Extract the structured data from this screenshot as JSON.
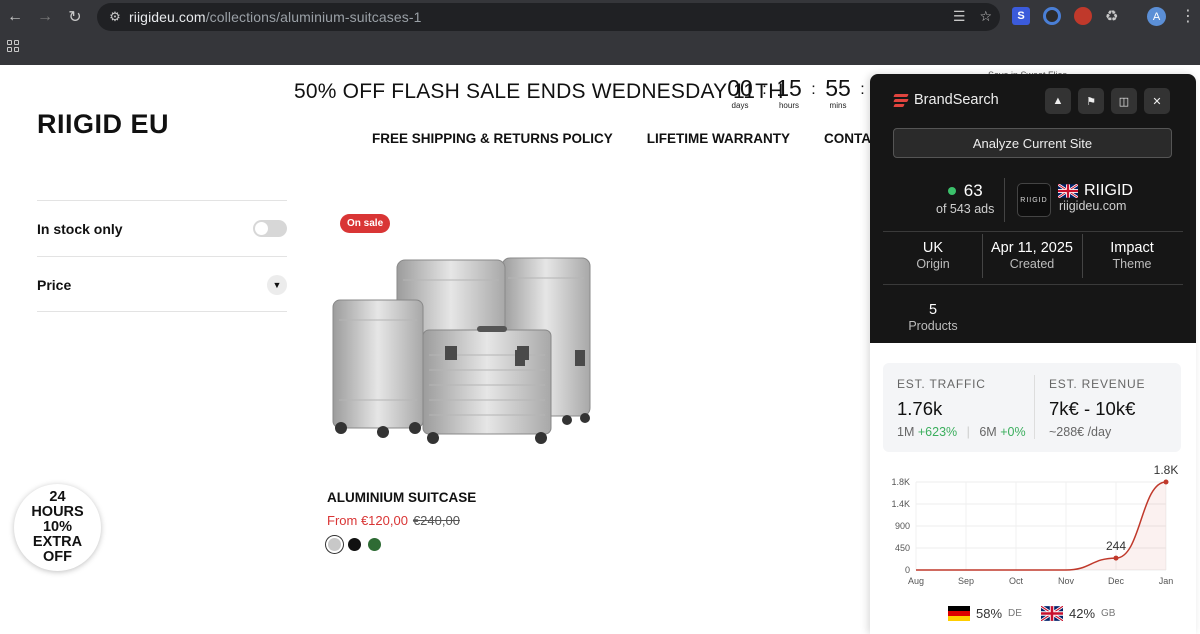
{
  "browser": {
    "url_host": "riigideu.com",
    "url_path": "/collections/aluminium-suitcases-1",
    "profile_initial": "A",
    "extensions": [
      "S",
      "",
      ""
    ]
  },
  "store": {
    "announcement": "50% OFF FLASH SALE ENDS WEDNESDAY 11TH",
    "countdown": [
      {
        "num": "00",
        "label": "days"
      },
      {
        "num": "15",
        "label": "hours"
      },
      {
        "num": "55",
        "label": "mins"
      }
    ],
    "save_tag": "Save in Sweat Flies",
    "logo": "RIIGID EU",
    "nav": [
      "FREE SHIPPING & RETURNS POLICY",
      "LIFETIME WARRANTY",
      "CONTACT"
    ],
    "filters": {
      "in_stock_label": "In stock only",
      "in_stock_on": false,
      "price_label": "Price"
    },
    "product": {
      "badge": "On sale",
      "title": "ALUMINIUM SUITCASE",
      "price_from": "From €120,00",
      "price_was": "€240,00",
      "swatches": [
        "#c8c8c8",
        "#111111",
        "#2e6b34"
      ]
    },
    "promo_badge": [
      "24",
      "HOURS",
      "10%",
      "EXTRA",
      "OFF"
    ]
  },
  "brandsearch": {
    "brand": "BrandSearch",
    "analyze_label": "Analyze Current Site",
    "ads_count": "63",
    "ads_total": "of 543 ads",
    "store_logo_text": "RIIGID",
    "store_name": "RIIGID",
    "store_domain": "riigideu.com",
    "origin": {
      "value": "UK",
      "label": "Origin"
    },
    "created": {
      "value": "Apr 11, 2025",
      "label": "Created"
    },
    "theme": {
      "value": "Impact",
      "label": "Theme"
    },
    "products": {
      "value": "5",
      "label": "Products"
    },
    "traffic": {
      "label": "EST. TRAFFIC",
      "value": "1.76k",
      "m1_label": "1M",
      "m1_change": "+623%",
      "m6_label": "6M",
      "m6_change": "+0%"
    },
    "revenue": {
      "label": "EST. REVENUE",
      "value": "7k€ - 10k€",
      "per_day": "~288€ /day"
    },
    "geo": [
      {
        "pct": "58%",
        "code": "DE"
      },
      {
        "pct": "42%",
        "code": "GB"
      }
    ]
  },
  "chart_data": {
    "type": "area",
    "categories": [
      "Aug",
      "Sep",
      "Oct",
      "Nov",
      "Dec",
      "Jan"
    ],
    "values": [
      0,
      0,
      0,
      0,
      244,
      1800
    ],
    "yticks": [
      "0",
      "450",
      "900",
      "1.4K",
      "1.8K"
    ],
    "ylim": [
      0,
      1800
    ],
    "point_labels": [
      {
        "index": 4,
        "text": "244"
      },
      {
        "index": 5,
        "text": "1.8K"
      }
    ],
    "line_color": "#c0392b",
    "grid": true
  }
}
